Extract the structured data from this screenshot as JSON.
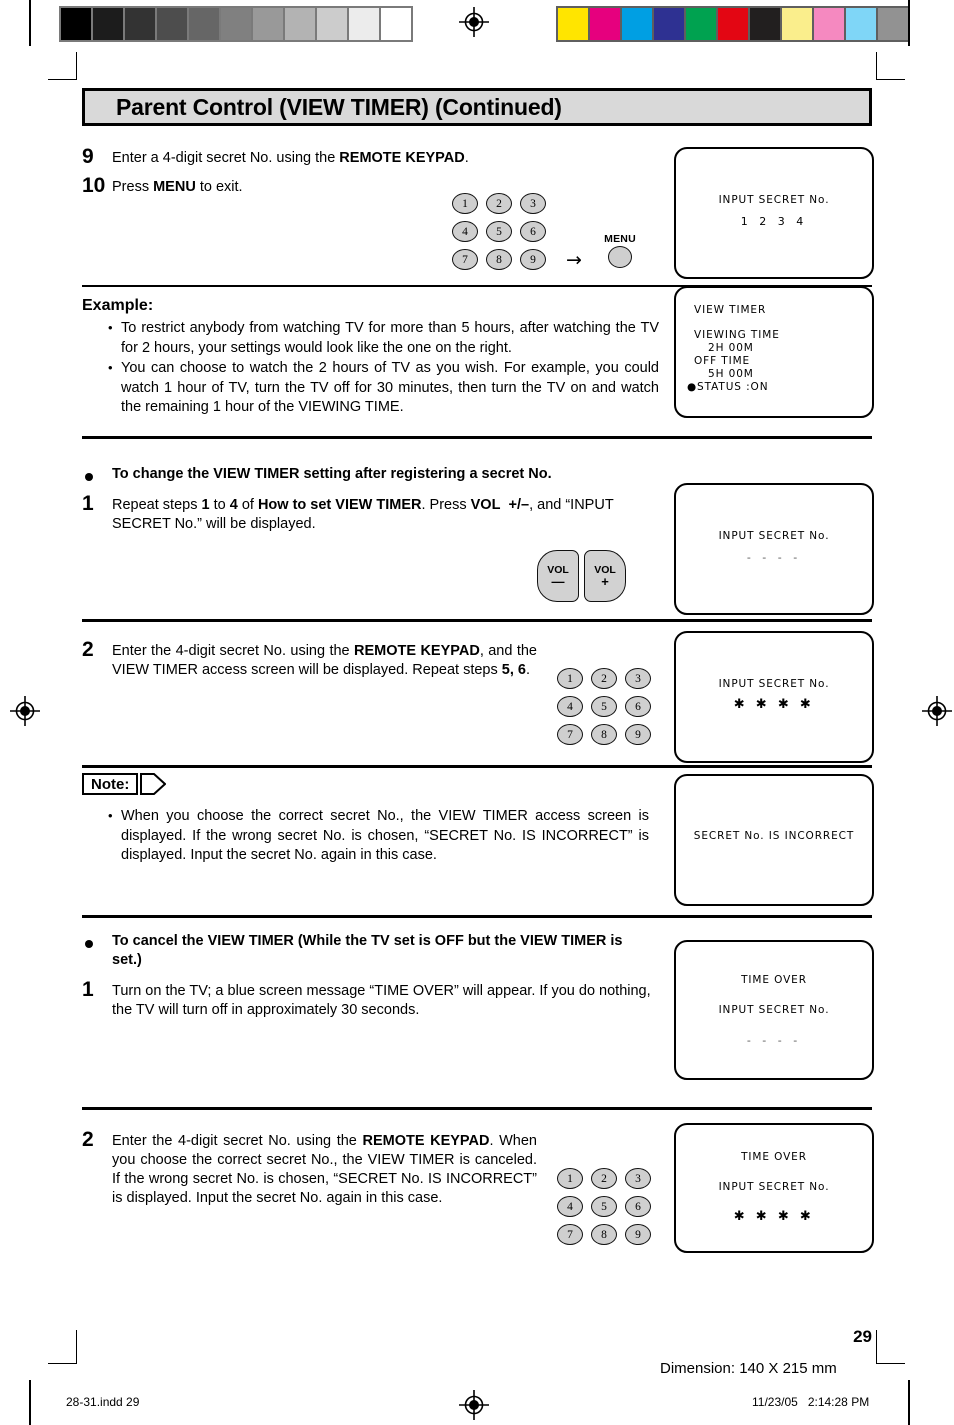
{
  "header": {
    "title": "Parent Control (VIEW TIMER) (Continued)"
  },
  "calibration": {
    "gray_swatches": [
      "#000000",
      "#1c1c1c",
      "#333333",
      "#4d4d4d",
      "#666666",
      "#808080",
      "#999999",
      "#b3b3b3",
      "#cccccc",
      "#ececec",
      "#ffffff"
    ],
    "color_swatches": [
      "#ffe500",
      "#e6007e",
      "#009fe3",
      "#2e3192",
      "#00a250",
      "#e30613",
      "#221f1f",
      "#faee8c",
      "#f589c0",
      "#7fd6f7",
      "#929292"
    ]
  },
  "steps": {
    "step9": {
      "number": "9",
      "text_html": "Enter a 4-digit secret No. using the <b>REMOTE KEYPAD</b>."
    },
    "step10": {
      "number": "10",
      "text_html": "Press <b>MENU</b> to exit."
    }
  },
  "keypad": {
    "keys": [
      "1",
      "2",
      "3",
      "4",
      "5",
      "6",
      "7",
      "8",
      "9"
    ],
    "arrow": "→",
    "menu_label": "MENU"
  },
  "volume": {
    "label": "VOL",
    "minus": "—",
    "plus": "+"
  },
  "example": {
    "label": "Example:",
    "bullets": [
      "To restrict anybody from watching TV for more than 5 hours, after watching the TV for 2 hours, your settings would look like the one on the right.",
      "You can choose to watch the 2 hours of TV as you wish. For example, you could watch 1 hour of TV, turn the TV off for 30 minutes, then turn the TV on and watch the remaining 1 hour of the VIEWING TIME."
    ]
  },
  "change_section": {
    "heading": "To change the VIEW TIMER setting after registering a secret No.",
    "step1": {
      "number": "1",
      "text_html": "Repeat steps <b>1</b> to <b>4</b> of <b>How to set VIEW TIMER</b>. Press <b>VOL&nbsp;&nbsp;+/–</b>, and “INPUT SECRET No.” will be displayed."
    },
    "step2": {
      "number": "2",
      "text_html": "Enter the 4-digit secret No. using the <b>REMOTE KEYPAD</b>, and the VIEW TIMER access screen will be displayed. Repeat steps <b>5, 6</b>."
    }
  },
  "note": {
    "label": "Note:",
    "bullets": [
      "When you choose the correct secret No., the VIEW TIMER access screen is displayed. If the wrong secret No. is chosen, “SECRET No. IS INCORRECT” is displayed. Input the secret No. again in this case."
    ]
  },
  "cancel_section": {
    "heading": "To cancel the VIEW TIMER (While the TV set is OFF but the VIEW TIMER is set.)",
    "step1": {
      "number": "1",
      "text_html": "Turn on the TV; a blue screen message “TIME OVER” will appear. If you do nothing, the TV will turn off in approximately 30 seconds."
    },
    "step2": {
      "number": "2",
      "text_html": "Enter the 4-digit secret No. using the <b>REMOTE KEYPAD</b>. When you choose the correct secret No., the VIEW TIMER is canceled. If the wrong secret No. is chosen, “SECRET No. IS INCORRECT” is displayed. Input the secret No. again in this case."
    }
  },
  "osd_screens": {
    "input_secret_1234": {
      "title": "INPUT SECRET No.",
      "value": "1 2 3 4"
    },
    "view_timer": {
      "title": "VIEW TIMER",
      "viewing_time_label": "VIEWING TIME",
      "viewing_time_value": "2H 00M",
      "off_time_label": "OFF TIME",
      "off_time_value": "5H 00M",
      "status_line": "●STATUS :ON"
    },
    "input_secret_blank": {
      "title": "INPUT SECRET No.",
      "value": "- - - -"
    },
    "input_secret_stars": {
      "title": "INPUT SECRET No.",
      "value": "✱ ✱ ✱ ✱"
    },
    "secret_incorrect": {
      "title": "SECRET No. IS INCORRECT"
    },
    "time_over_blank": {
      "title": "TIME OVER",
      "subtitle": "INPUT SECRET No.",
      "value": "- - - -"
    },
    "time_over_stars": {
      "title": "TIME OVER",
      "subtitle": "INPUT SECRET No.",
      "value": "✱ ✱ ✱ ✱"
    }
  },
  "footer": {
    "page_number": "29",
    "dimension": "Dimension: 140  X 215 mm",
    "file_label": "28-31.indd   29",
    "timestamp": "11/23/05   2:14:28 PM"
  }
}
